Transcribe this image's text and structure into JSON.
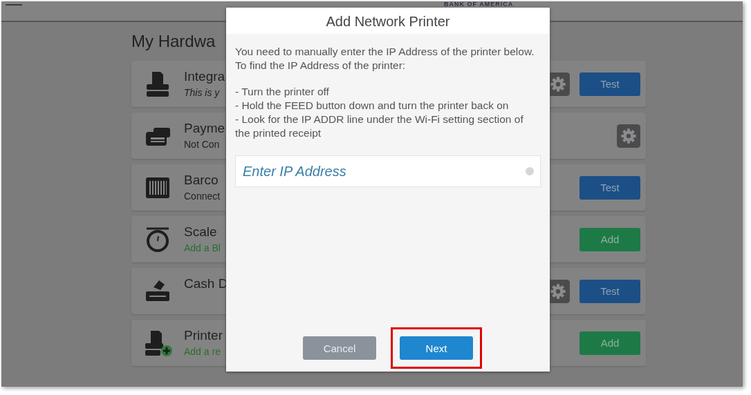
{
  "top_bar": {
    "logo": "BANK OF AMERICA"
  },
  "page": {
    "heading": "My Hardwa",
    "devices": [
      {
        "kind": "printer",
        "name": "Integra",
        "subtitle": "This is y",
        "italic": true,
        "prompt": false,
        "actions": [
          {
            "kind": "gear"
          },
          {
            "kind": "test",
            "label": "Test"
          }
        ]
      },
      {
        "kind": "card-reader",
        "name": "Payme",
        "subtitle": "Not Con",
        "italic": false,
        "prompt": false,
        "actions": [
          {
            "kind": "gear"
          }
        ]
      },
      {
        "kind": "barcode",
        "name": "Barco",
        "subtitle": "Connect",
        "italic": false,
        "prompt": false,
        "actions": [
          {
            "kind": "test",
            "label": "Test"
          }
        ]
      },
      {
        "kind": "scale",
        "name": "Scale",
        "subtitle": "Add a Bl",
        "italic": false,
        "prompt": true,
        "actions": [
          {
            "kind": "add",
            "label": "Add"
          }
        ]
      },
      {
        "kind": "cash-drawer",
        "name": "Cash D",
        "actions": [
          {
            "kind": "gear"
          },
          {
            "kind": "test",
            "label": "Test"
          }
        ]
      },
      {
        "kind": "add-printer",
        "name": "Printer",
        "subtitle": "Add a re",
        "italic": false,
        "prompt": true,
        "actions": [
          {
            "kind": "add",
            "label": "Add"
          }
        ]
      }
    ]
  },
  "dialog": {
    "title": "Add Network Printer",
    "intro": "You need to manually enter the IP Address of the printer below. To find the IP Address of the printer:",
    "steps": [
      "- Turn the printer off",
      "- Hold the FEED button down and turn the printer back on",
      "- Look for the IP ADDR line under the Wi-Fi setting section of the printed receipt"
    ],
    "field": {
      "placeholder": "Enter IP Address"
    },
    "buttons": [
      {
        "kind": "cancel",
        "label": "Cancel",
        "highlighted": false
      },
      {
        "kind": "next",
        "label": "Next",
        "highlighted": true
      }
    ]
  }
}
